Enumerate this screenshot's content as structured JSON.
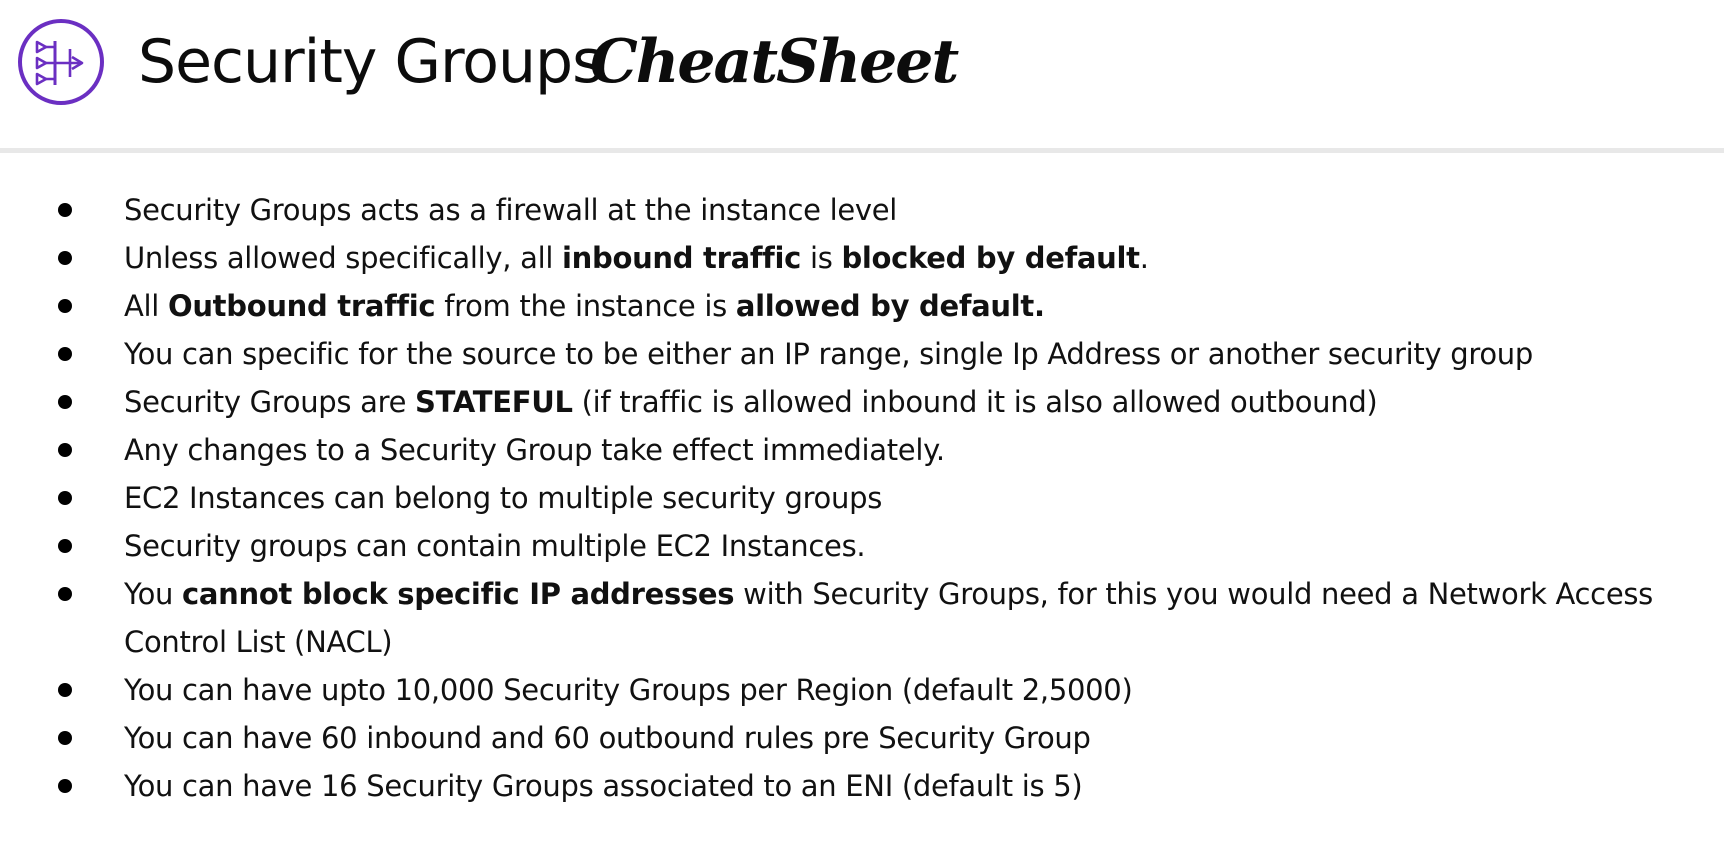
{
  "header": {
    "title": "Security Groups",
    "title_accent": "CheatSheet",
    "icon": "security-group-icon",
    "icon_color": "#6b2fc2"
  },
  "bullets": [
    {
      "segments": [
        {
          "text": "Security Groups acts as a firewall at the instance level",
          "bold": false
        }
      ]
    },
    {
      "segments": [
        {
          "text": "Unless allowed specifically, all ",
          "bold": false
        },
        {
          "text": "inbound traffic",
          "bold": true
        },
        {
          "text": " is ",
          "bold": false
        },
        {
          "text": "blocked by default",
          "bold": true
        },
        {
          "text": ".",
          "bold": false
        }
      ]
    },
    {
      "segments": [
        {
          "text": "All ",
          "bold": false
        },
        {
          "text": "Outbound traffic",
          "bold": true
        },
        {
          "text": " from the instance is ",
          "bold": false
        },
        {
          "text": "allowed by default.",
          "bold": true
        }
      ]
    },
    {
      "segments": [
        {
          "text": "You can specific for the source to be either an IP range, single Ip Address or another security group",
          "bold": false
        }
      ]
    },
    {
      "segments": [
        {
          "text": "Security Groups are ",
          "bold": false
        },
        {
          "text": "STATEFUL",
          "bold": true
        },
        {
          "text": "  (if traffic is allowed inbound it is also allowed outbound)",
          "bold": false
        }
      ]
    },
    {
      "segments": [
        {
          "text": "Any changes to a Security Group take effect immediately.",
          "bold": false
        }
      ]
    },
    {
      "segments": [
        {
          "text": "EC2 Instances can belong to multiple security groups",
          "bold": false
        }
      ]
    },
    {
      "segments": [
        {
          "text": "Security groups can contain multiple EC2 Instances.",
          "bold": false
        }
      ]
    },
    {
      "segments": [
        {
          "text": "You ",
          "bold": false
        },
        {
          "text": "cannot block specific IP addresses",
          "bold": true
        },
        {
          "text": " with Security Groups, for this you would need a Network Access Control List (NACL)",
          "bold": false
        }
      ]
    },
    {
      "segments": [
        {
          "text": "You can have upto 10,000 Security Groups per Region (default 2,5000)",
          "bold": false
        }
      ]
    },
    {
      "segments": [
        {
          "text": "You can have 60 inbound and 60 outbound rules pre Security Group",
          "bold": false
        }
      ]
    },
    {
      "segments": [
        {
          "text": "You can have 16 Security Groups associated to an ENI (default is 5)",
          "bold": false
        }
      ]
    }
  ]
}
